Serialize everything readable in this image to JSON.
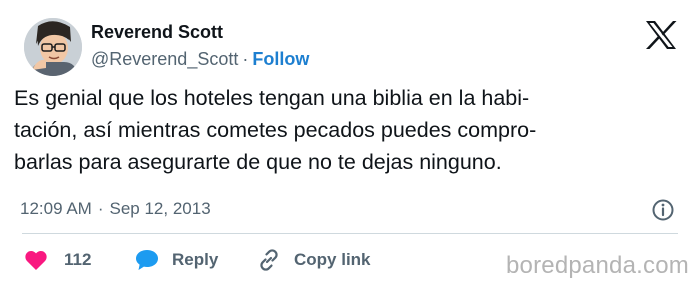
{
  "author": {
    "display_name": "Reverend Scott",
    "handle": "@Reverend_Scott",
    "separator": "·",
    "follow_label": "Follow"
  },
  "tweet": {
    "lines": [
      "Es genial que los hoteles tengan una biblia en la habi-",
      "tación, así mientras cometes pecados puedes compro-",
      "barlas para asegurarte de que no te dejas ninguno."
    ]
  },
  "meta": {
    "time": "12:09 AM",
    "separator": "·",
    "date": "Sep 12, 2013"
  },
  "actions": {
    "like_count": "112",
    "reply_label": "Reply",
    "copy_link_label": "Copy link"
  },
  "watermark": "boredpanda.com",
  "colors": {
    "accent": "#1d7fd0",
    "like": "#f91880",
    "reply": "#1d9bf0",
    "muted": "#536471",
    "text": "#0f1419"
  },
  "icons": {
    "platform": "x-logo-icon",
    "info": "info-icon",
    "like": "heart-icon",
    "reply": "speech-bubble-icon",
    "copy_link": "link-icon"
  }
}
